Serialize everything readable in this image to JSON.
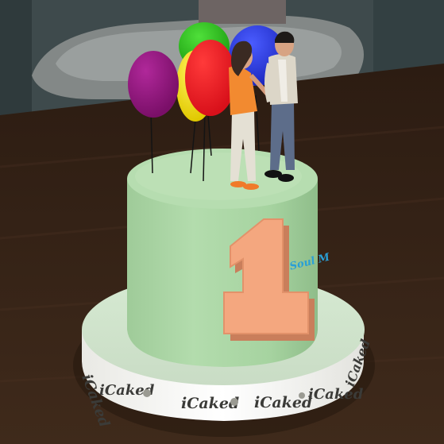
{
  "scene": {
    "cake_number": "1",
    "side_text": "Soul M",
    "brand_labels": [
      "iCaked",
      "iCaked",
      "iCaked",
      "iCaked",
      "iCaked",
      "iCaked"
    ]
  },
  "colors": {
    "wall": "#3d4a4c",
    "table": "#3a2618",
    "cake_body": "#a8d3a2",
    "cake_top": "#b8deb2",
    "plate": "#e2efdf",
    "number": "#f4a77f",
    "number_shadow": "#d98c66",
    "script_text": "#2a9fd6",
    "balloon_purple": "#8b1577",
    "balloon_red": "#f01820",
    "balloon_yellow": "#f6e30c",
    "balloon_green": "#29c41b",
    "balloon_blue": "#2a3be0"
  }
}
